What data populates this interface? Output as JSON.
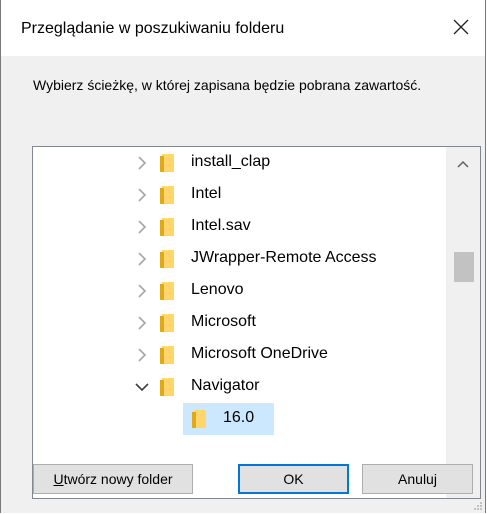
{
  "dialog": {
    "title": "Przeglądanie w poszukiwaniu folderu",
    "close_icon": "×",
    "instruction": "Wybierz ścieżkę, w której zapisana będzie pobrana zawartość."
  },
  "tree": {
    "items": [
      {
        "label": "install_clap",
        "expanded": false,
        "selected": false
      },
      {
        "label": "Intel",
        "expanded": false,
        "selected": false
      },
      {
        "label": "Intel.sav",
        "expanded": false,
        "selected": false
      },
      {
        "label": "JWrapper-Remote Access",
        "expanded": false,
        "selected": false
      },
      {
        "label": "Lenovo",
        "expanded": false,
        "selected": false
      },
      {
        "label": "Microsoft",
        "expanded": false,
        "selected": false
      },
      {
        "label": "Microsoft OneDrive",
        "expanded": false,
        "selected": false
      },
      {
        "label": "Navigator",
        "expanded": true,
        "selected": false
      },
      {
        "label": "16.0",
        "expanded": false,
        "selected": true,
        "child": true
      }
    ],
    "scroll_up_glyph": "^",
    "scroll_down_glyph": "v",
    "folder_color": "#ffd66b",
    "selection_color": "#cce8ff"
  },
  "buttons": {
    "new_folder": "Utwórz nowy folder",
    "new_folder_access_key": "U",
    "new_folder_rest": "twórz nowy folder",
    "ok": "OK",
    "cancel": "Anuluj"
  }
}
